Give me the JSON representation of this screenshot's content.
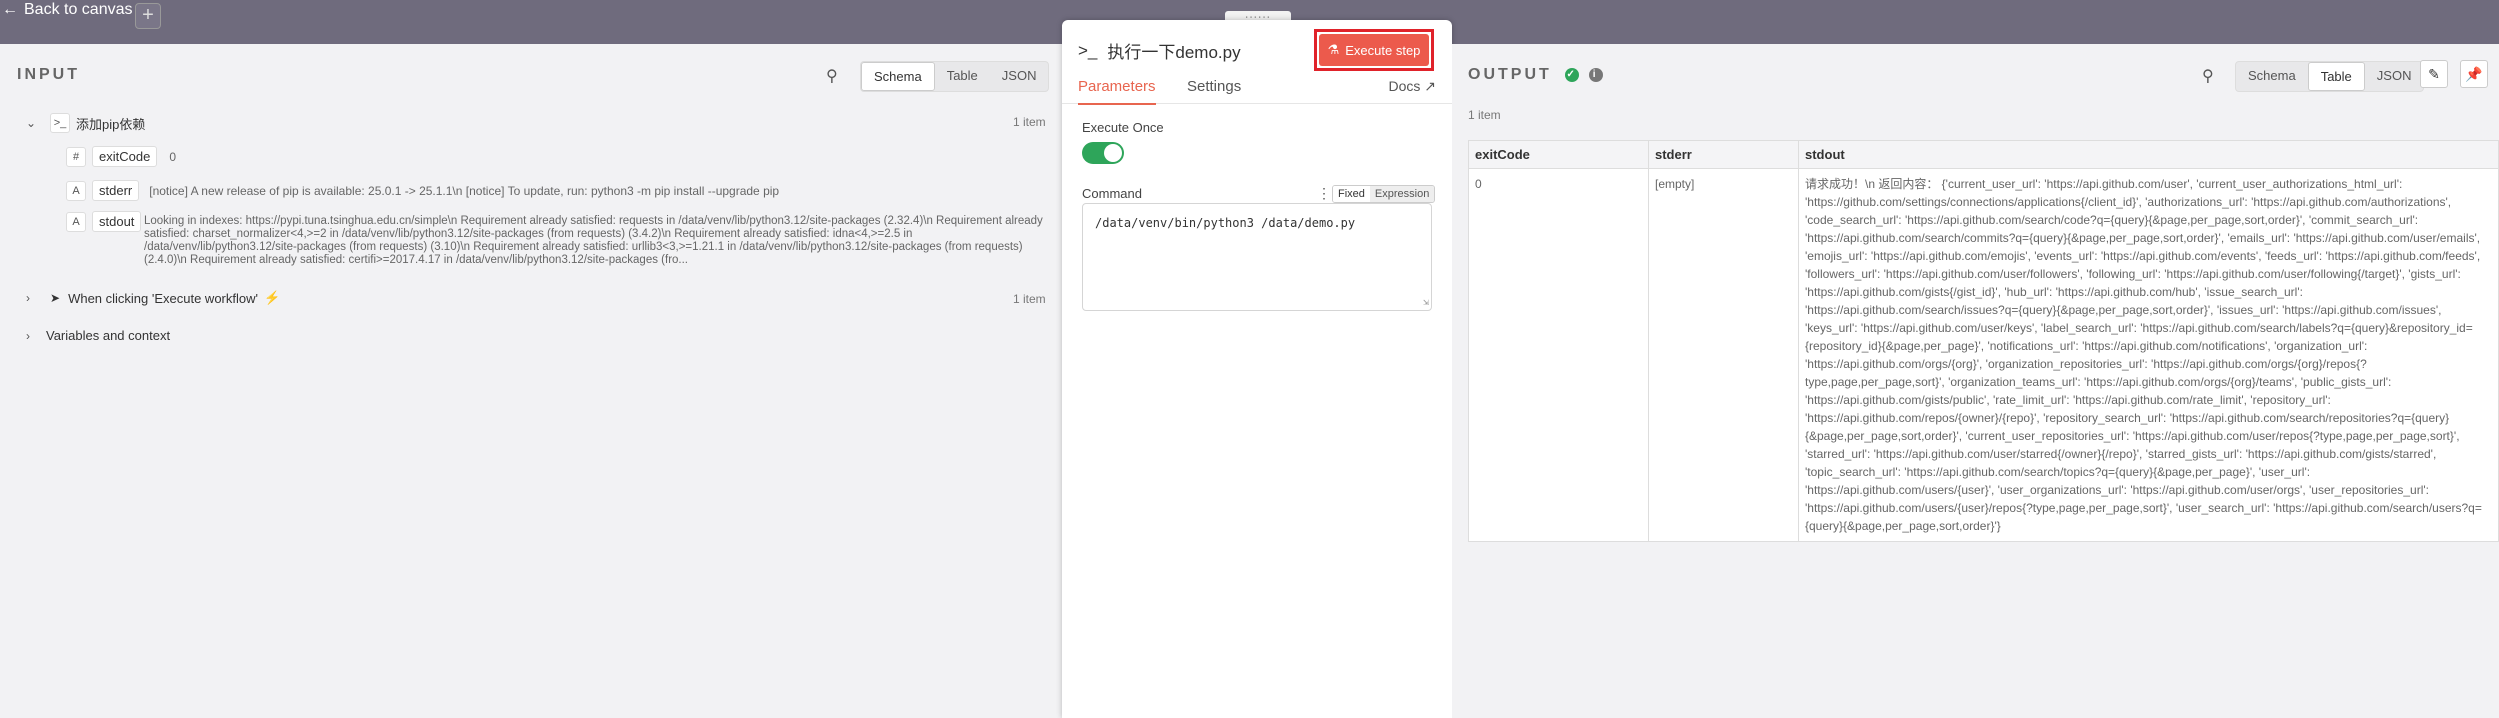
{
  "topbar": {
    "back_label": "Back to canvas",
    "plus_label": "+",
    "handle_label": "::::::"
  },
  "input": {
    "title": "INPUT",
    "tabs": [
      "Schema",
      "Table",
      "JSON"
    ],
    "active_tab": "Schema",
    "tree": {
      "root_label": "添加pip依赖",
      "root_count": "1 item",
      "fields": [
        {
          "type": "#",
          "key": "exitCode",
          "value": "0"
        },
        {
          "type": "A",
          "key": "stderr",
          "value": "[notice] A new release of pip is available: 25.0.1 -> 25.1.1\\n [notice] To update, run: python3 -m pip install --upgrade pip"
        },
        {
          "type": "A",
          "key": "stdout",
          "value": "Looking in indexes: https://pypi.tuna.tsinghua.edu.cn/simple\\n Requirement already satisfied: requests in /data/venv/lib/python3.12/site-packages (2.32.4)\\n Requirement already satisfied: charset_normalizer<4,>=2 in /data/venv/lib/python3.12/site-packages (from requests) (3.4.2)\\n Requirement already satisfied: idna<4,>=2.5 in /data/venv/lib/python3.12/site-packages (from requests) (3.10)\\n Requirement already satisfied: urllib3<3,>=1.21.1 in /data/venv/lib/python3.12/site-packages (from requests) (2.4.0)\\n Requirement already satisfied: certifi>=2017.4.17 in /data/venv/lib/python3.12/site-packages (fro..."
        }
      ],
      "trigger_label": "When clicking 'Execute workflow'",
      "trigger_count": "1 item",
      "vars_label": "Variables and context"
    }
  },
  "node": {
    "title": "执行一下demo.py",
    "execute_label": "Execute step",
    "tabs": [
      "Parameters",
      "Settings"
    ],
    "docs_label": "Docs",
    "execute_once_label": "Execute Once",
    "execute_once": true,
    "command_label": "Command",
    "mode_fixed": "Fixed",
    "mode_expression": "Expression",
    "command_value": "/data/venv/bin/python3 /data/demo.py"
  },
  "output": {
    "title": "OUTPUT",
    "count": "1 item",
    "tabs": [
      "Schema",
      "Table",
      "JSON"
    ],
    "active_tab": "Table",
    "columns": [
      "exitCode",
      "stderr",
      "stdout"
    ],
    "row": {
      "exitCode": "0",
      "stderr": "[empty]",
      "stdout": "请求成功！\\n 返回内容： {'current_user_url': 'https://api.github.com/user', 'current_user_authorizations_html_url': 'https://github.com/settings/connections/applications{/client_id}', 'authorizations_url': 'https://api.github.com/authorizations', 'code_search_url': 'https://api.github.com/search/code?q={query}{&page,per_page,sort,order}', 'commit_search_url': 'https://api.github.com/search/commits?q={query}{&page,per_page,sort,order}', 'emails_url': 'https://api.github.com/user/emails', 'emojis_url': 'https://api.github.com/emojis', 'events_url': 'https://api.github.com/events', 'feeds_url': 'https://api.github.com/feeds', 'followers_url': 'https://api.github.com/user/followers', 'following_url': 'https://api.github.com/user/following{/target}', 'gists_url': 'https://api.github.com/gists{/gist_id}', 'hub_url': 'https://api.github.com/hub', 'issue_search_url': 'https://api.github.com/search/issues?q={query}{&page,per_page,sort,order}', 'issues_url': 'https://api.github.com/issues', 'keys_url': 'https://api.github.com/user/keys', 'label_search_url': 'https://api.github.com/search/labels?q={query}&repository_id={repository_id}{&page,per_page}', 'notifications_url': 'https://api.github.com/notifications', 'organization_url': 'https://api.github.com/orgs/{org}', 'organization_repositories_url': 'https://api.github.com/orgs/{org}/repos{?type,page,per_page,sort}', 'organization_teams_url': 'https://api.github.com/orgs/{org}/teams', 'public_gists_url': 'https://api.github.com/gists/public', 'rate_limit_url': 'https://api.github.com/rate_limit', 'repository_url': 'https://api.github.com/repos/{owner}/{repo}', 'repository_search_url': 'https://api.github.com/search/repositories?q={query}{&page,per_page,sort,order}', 'current_user_repositories_url': 'https://api.github.com/user/repos{?type,page,per_page,sort}', 'starred_url': 'https://api.github.com/user/starred{/owner}{/repo}', 'starred_gists_url': 'https://api.github.com/gists/starred', 'topic_search_url': 'https://api.github.com/search/topics?q={query}{&page,per_page}', 'user_url': 'https://api.github.com/users/{user}', 'user_organizations_url': 'https://api.github.com/user/orgs', 'user_repositories_url': 'https://api.github.com/users/{user}/repos{?type,page,per_page,sort}', 'user_search_url': 'https://api.github.com/search/users?q={query}{&page,per_page,sort,order}'}"
    }
  },
  "colors": {
    "accent": "#e8654f",
    "execute_button": "#ec5a4c",
    "success": "#2ea55a",
    "error": "#d9463e"
  }
}
